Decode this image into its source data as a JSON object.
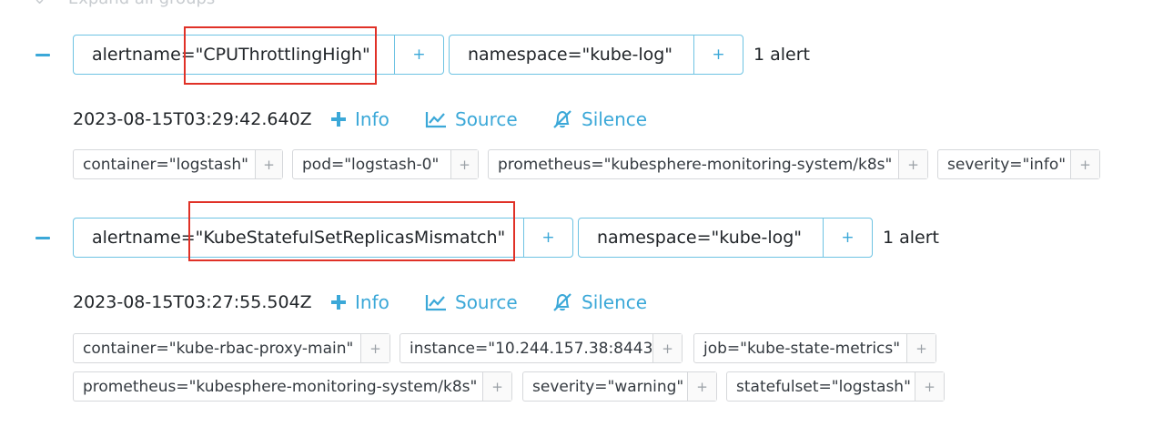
{
  "header": {
    "expand_all_label": "Expand all groups"
  },
  "groups": [
    {
      "labels": [
        {
          "text": "alertname=\"CPUThrottlingHigh\"",
          "plus": "+"
        },
        {
          "text": "namespace=\"kube-log\"",
          "plus": "+"
        }
      ],
      "count": "1 alert",
      "alert": {
        "timestamp": "2023-08-15T03:29:42.640Z",
        "actions": {
          "info": "Info",
          "source": "Source",
          "silence": "Silence"
        },
        "labels": [
          {
            "text": "container=\"logstash\"",
            "plus": "+"
          },
          {
            "text": "pod=\"logstash-0\"",
            "plus": "+"
          },
          {
            "text": "prometheus=\"kubesphere-monitoring-system/k8s\"",
            "plus": "+"
          },
          {
            "text": "severity=\"info\"",
            "plus": "+"
          }
        ]
      }
    },
    {
      "labels": [
        {
          "text": "alertname=\"KubeStatefulSetReplicasMismatch\"",
          "plus": "+"
        },
        {
          "text": "namespace=\"kube-log\"",
          "plus": "+"
        }
      ],
      "count": "1 alert",
      "alert": {
        "timestamp": "2023-08-15T03:27:55.504Z",
        "actions": {
          "info": "Info",
          "source": "Source",
          "silence": "Silence"
        },
        "labels": [
          {
            "text": "container=\"kube-rbac-proxy-main\"",
            "plus": "+"
          },
          {
            "text": "instance=\"10.244.157.38:8443\"",
            "plus": "+"
          },
          {
            "text": "job=\"kube-state-metrics\"",
            "plus": "+"
          },
          {
            "text": "prometheus=\"kubesphere-monitoring-system/k8s\"",
            "plus": "+"
          },
          {
            "text": "severity=\"warning\"",
            "plus": "+"
          },
          {
            "text": "statefulset=\"logstash\"",
            "plus": "+"
          }
        ]
      }
    }
  ],
  "colors": {
    "accent": "#3ba8d8",
    "highlight": "#e03127",
    "chip_border": "#6ec3e3"
  }
}
